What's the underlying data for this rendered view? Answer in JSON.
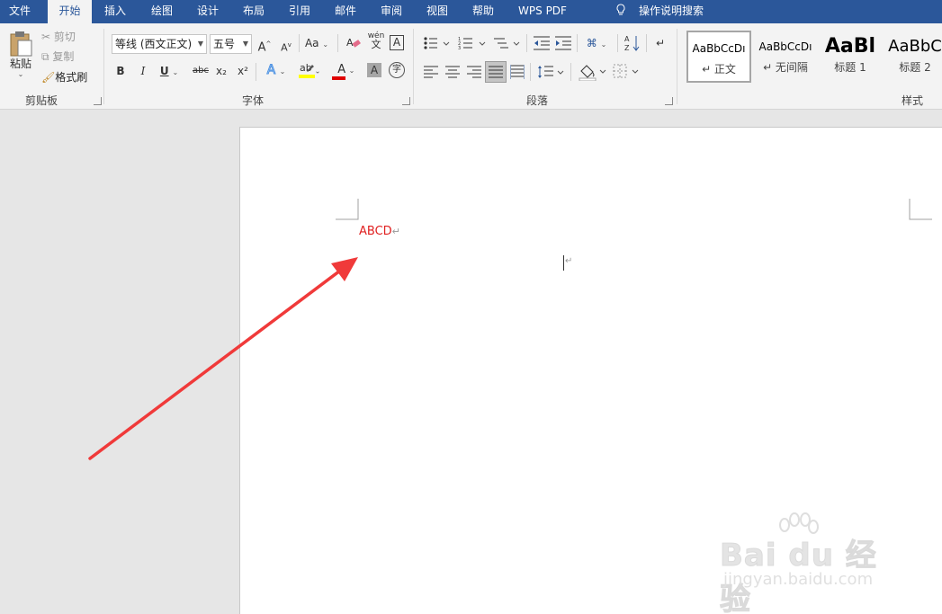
{
  "menu": {
    "tabs": [
      {
        "label": "文件"
      },
      {
        "label": "开始"
      },
      {
        "label": "插入"
      },
      {
        "label": "绘图"
      },
      {
        "label": "设计"
      },
      {
        "label": "布局"
      },
      {
        "label": "引用"
      },
      {
        "label": "邮件"
      },
      {
        "label": "审阅"
      },
      {
        "label": "视图"
      },
      {
        "label": "帮助"
      },
      {
        "label": "WPS PDF"
      }
    ],
    "active_tab": "开始",
    "tell_me": "操作说明搜索"
  },
  "ribbon": {
    "clipboard": {
      "paste": "粘贴",
      "cut": "剪切",
      "copy": "复制",
      "format_painter": "格式刷",
      "group_label": "剪贴板"
    },
    "font": {
      "font_name": "等线 (西文正文)",
      "font_size": "五号",
      "bold": "B",
      "italic": "I",
      "underline": "U",
      "strike": "abc",
      "subscript": "x₂",
      "superscript": "x²",
      "change_case": "Aa",
      "phonetic_top": "wén",
      "phonetic_bottom": "文",
      "grow": "A",
      "shrink": "A",
      "char_border": "A",
      "text_effect": "A",
      "font_color": "A",
      "char_shading": "A",
      "enclose": "字",
      "highlight_color": "#ffff00",
      "font_color_value": "#e00000",
      "group_label": "字体"
    },
    "paragraph": {
      "group_label": "段落"
    },
    "styles": {
      "items": [
        {
          "sample": "AaBbCcDı",
          "name": "↵ 正文"
        },
        {
          "sample": "AaBbCcDı",
          "name": "↵ 无间隔"
        },
        {
          "sample": "AaBl",
          "name": "标题 1"
        },
        {
          "sample": "AaBbC",
          "name": "标题 2"
        }
      ],
      "group_label": "样式"
    }
  },
  "document": {
    "text": "ABCD",
    "text_color": "#e02020",
    "para_mark": "↵"
  },
  "watermark": {
    "brand": "Bai du 经验",
    "url": "jingyan.baidu.com"
  }
}
